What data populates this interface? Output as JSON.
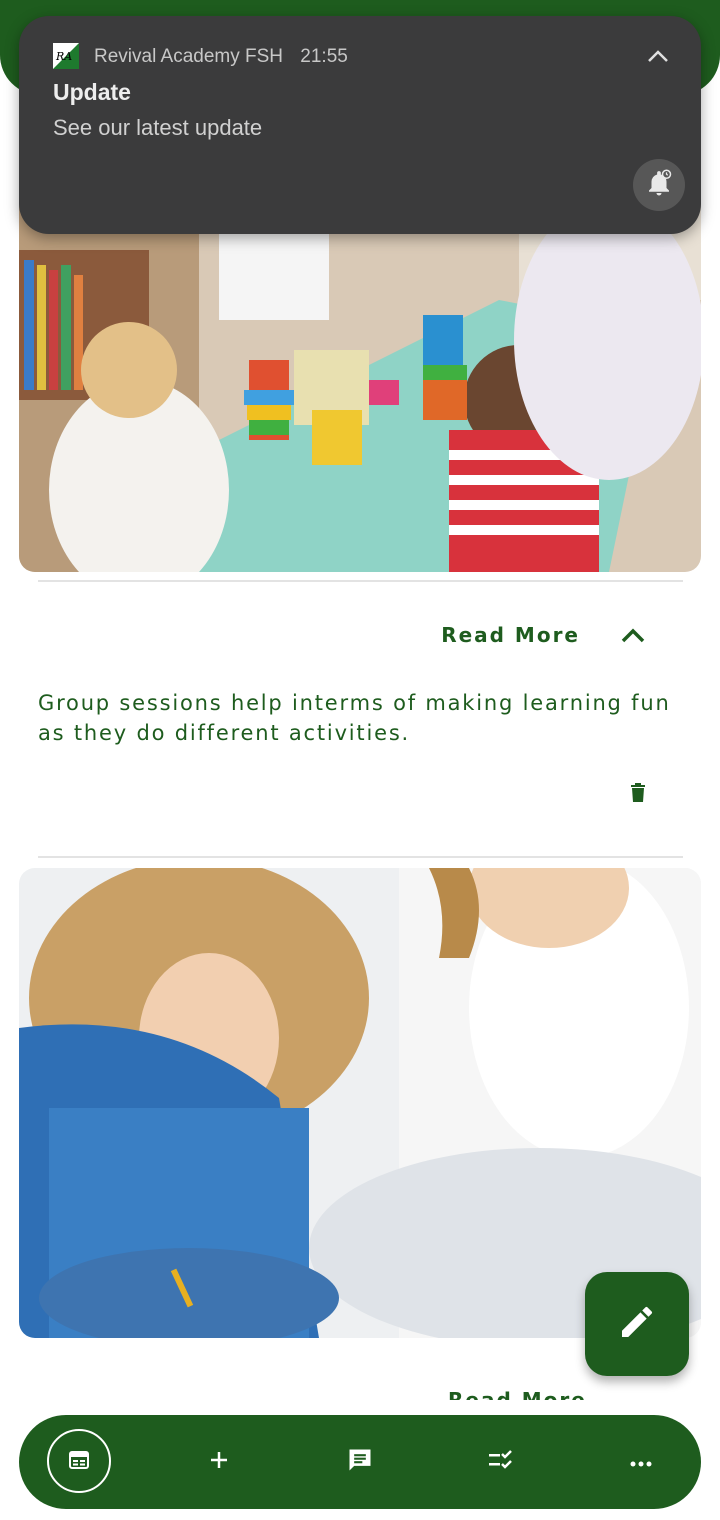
{
  "theme": {
    "primary": "#1e5c1e",
    "notification_bg": "#3b3b3c"
  },
  "notification": {
    "app_name": "Revival Academy FSH",
    "time": "21:55",
    "title": "Update",
    "body": "See our latest update",
    "app_icon_text": "RA",
    "collapse_icon": "chevron-up-icon",
    "snooze_icon": "snooze-bell-icon"
  },
  "posts": [
    {
      "image_subject": "children playing with colorful stacking toys at a table with a teacher",
      "read_more_label": "Read More",
      "expand_icon": "chevron-up-icon",
      "text": "Group sessions help interms of making learning fun as they do different activities.",
      "delete_icon": "trash-icon"
    },
    {
      "image_subject": "girl drawing on the floor next to a woman",
      "read_more_label": "Read More"
    }
  ],
  "fab": {
    "icon": "pencil-icon"
  },
  "bottom_nav": {
    "items": [
      {
        "icon": "calendar-icon",
        "active": true
      },
      {
        "icon": "plus-icon",
        "active": false
      },
      {
        "icon": "chat-icon",
        "active": false
      },
      {
        "icon": "checklist-icon",
        "active": false
      },
      {
        "icon": "more-horizontal-icon",
        "active": false
      }
    ]
  }
}
